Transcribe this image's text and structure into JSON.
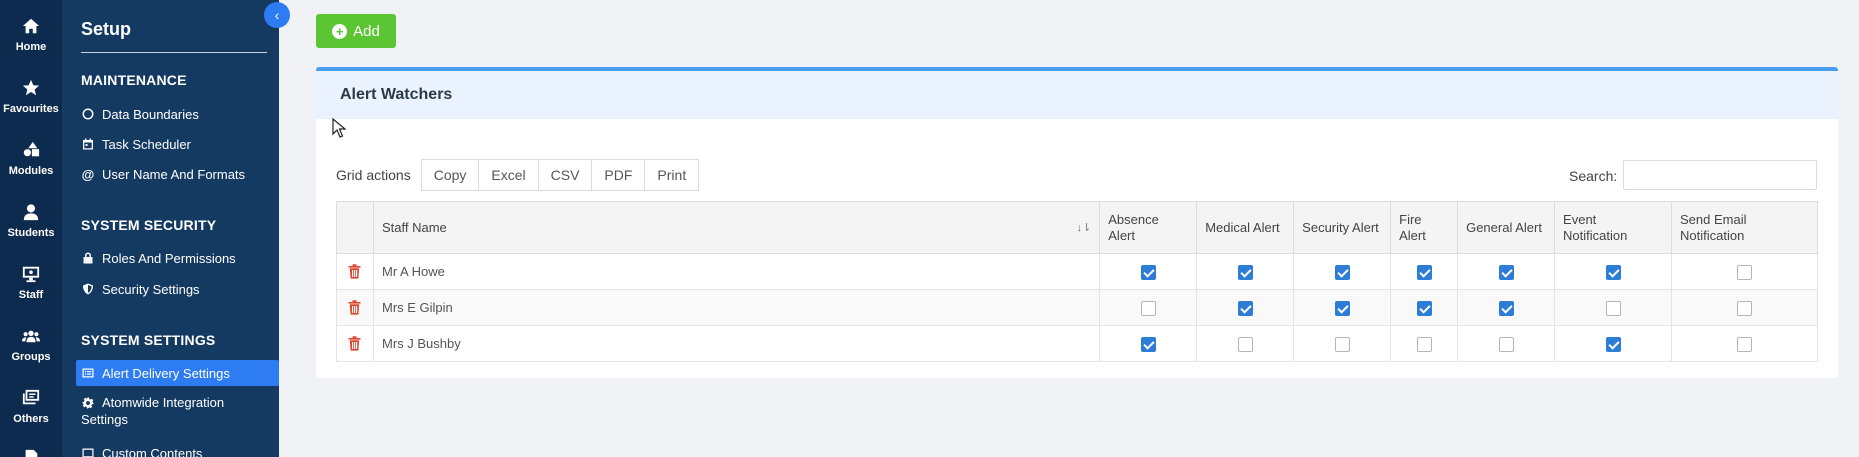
{
  "rail": {
    "items": [
      {
        "label": "Home",
        "icon": "home-icon"
      },
      {
        "label": "Favourites",
        "icon": "star-icon"
      },
      {
        "label": "Modules",
        "icon": "modules-icon"
      },
      {
        "label": "Students",
        "icon": "student-icon"
      },
      {
        "label": "Staff",
        "icon": "staff-icon"
      },
      {
        "label": "Groups",
        "icon": "groups-icon"
      },
      {
        "label": "Others",
        "icon": "others-icon"
      }
    ]
  },
  "sidebar": {
    "title": "Setup",
    "sections": [
      {
        "heading": "MAINTENANCE",
        "items": [
          "Data Boundaries",
          "Task Scheduler",
          "User Name And Formats"
        ]
      },
      {
        "heading": "SYSTEM SECURITY",
        "items": [
          "Roles And Permissions",
          "Security Settings"
        ]
      },
      {
        "heading": "SYSTEM SETTINGS",
        "items": [
          "Alert Delivery Settings",
          "Atomwide Integration Settings",
          "Custom Contents"
        ]
      }
    ],
    "active_item": "Alert Delivery Settings",
    "collapse_symbol": "‹"
  },
  "toolbar": {
    "add_label": "Add"
  },
  "panel": {
    "title": "Alert Watchers"
  },
  "grid_actions": {
    "label": "Grid actions",
    "buttons": [
      "Copy",
      "Excel",
      "CSV",
      "PDF",
      "Print"
    ]
  },
  "search": {
    "label": "Search:",
    "value": "",
    "placeholder": ""
  },
  "table": {
    "columns": [
      "Staff Name",
      "Absence Alert",
      "Medical Alert",
      "Security Alert",
      "Fire Alert",
      "General Alert",
      "Event Notification",
      "Send Email Notification"
    ],
    "rows": [
      {
        "name": "Mr A Howe",
        "checks": [
          true,
          true,
          true,
          true,
          true,
          true,
          false
        ]
      },
      {
        "name": "Mrs E Gilpin",
        "checks": [
          false,
          true,
          true,
          true,
          true,
          false,
          false
        ]
      },
      {
        "name": "Mrs J Bushby",
        "checks": [
          true,
          false,
          false,
          false,
          false,
          true,
          false
        ]
      }
    ]
  },
  "colors": {
    "accent": "#2d7cf2",
    "add": "#5cc534",
    "delete": "#e0452e",
    "checkbox": "#2d7cd6"
  }
}
